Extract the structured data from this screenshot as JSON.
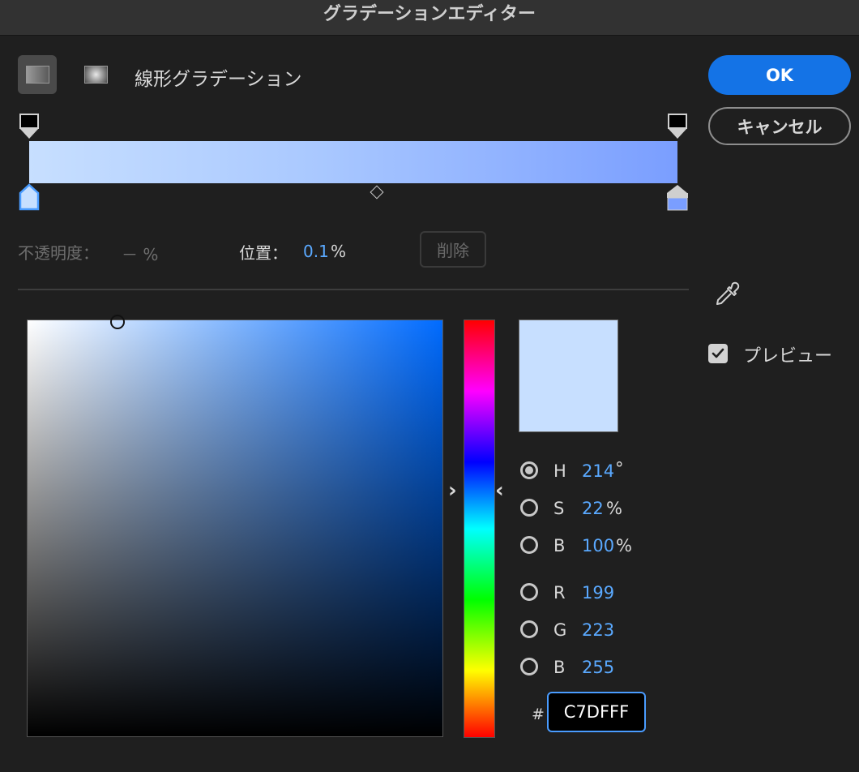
{
  "window": {
    "title": "グラデーションエディター"
  },
  "gradient": {
    "type_label": "線形グラデーション",
    "selected_type": "linear",
    "colors": {
      "left": "#c7dfff",
      "mid": "#a9c8ff",
      "right": "#7a9eff"
    }
  },
  "stop": {
    "opacity_label": "不透明度：",
    "opacity_value": "－ %",
    "position_label": "位置：",
    "position_value": "0.1",
    "position_unit": "%",
    "delete_label": "削除"
  },
  "buttons": {
    "ok": "OK",
    "cancel": "キャンセル"
  },
  "picker": {
    "preview_color": "#c7dfff",
    "channels": [
      {
        "key": "H",
        "value": "214",
        "unit": "°",
        "selected": true
      },
      {
        "key": "S",
        "value": "22",
        "unit": "%",
        "selected": false
      },
      {
        "key": "B",
        "value": "100",
        "unit": "%",
        "selected": false
      },
      {
        "key": "R",
        "value": "199",
        "unit": "",
        "selected": false
      },
      {
        "key": "G",
        "value": "223",
        "unit": "",
        "selected": false
      },
      {
        "key": "B",
        "value": "255",
        "unit": "",
        "selected": false
      }
    ],
    "hex_prefix": "#",
    "hex_value": "C7DFFF"
  },
  "options": {
    "preview_label": "プレビュー",
    "preview_checked": true
  },
  "icons": {
    "linear": "linear-gradient-icon",
    "radial": "radial-gradient-icon",
    "eyedropper": "eyedropper-icon",
    "hue_left": "chevron-right-icon",
    "hue_right": "chevron-left-icon"
  }
}
